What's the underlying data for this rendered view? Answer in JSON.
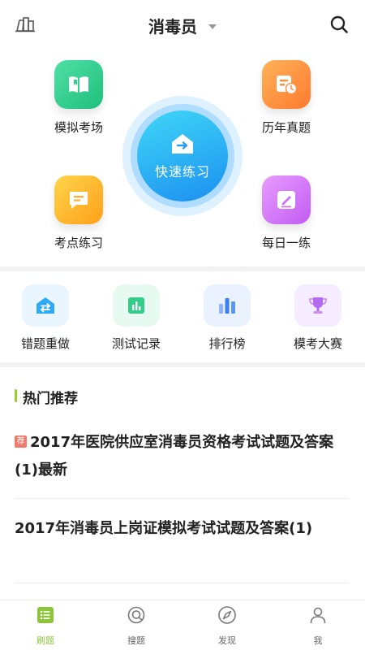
{
  "header": {
    "title": "消毒员"
  },
  "modes": {
    "mock_exam": "模拟考场",
    "past_exams": "历年真题",
    "quick_practice": "快速练习",
    "keypoint_practice": "考点练习",
    "daily_practice": "每日一练"
  },
  "tools": [
    {
      "label": "错题重做"
    },
    {
      "label": "测试记录"
    },
    {
      "label": "排行榜"
    },
    {
      "label": "模考大赛"
    }
  ],
  "hot": {
    "title": "热门推荐",
    "articles": [
      {
        "tag": "荐",
        "title": "2017年医院供应室消毒员资格考试试题及答案(1)最新"
      },
      {
        "title": "2017年消毒员上岗证模拟考试试题及答案(1)"
      }
    ]
  },
  "tabs": [
    {
      "label": "刷题",
      "active": true
    },
    {
      "label": "搜题"
    },
    {
      "label": "发现"
    },
    {
      "label": "我"
    }
  ],
  "colors": {
    "accent": "#8cc43a",
    "quick": "#1c8ff0"
  }
}
